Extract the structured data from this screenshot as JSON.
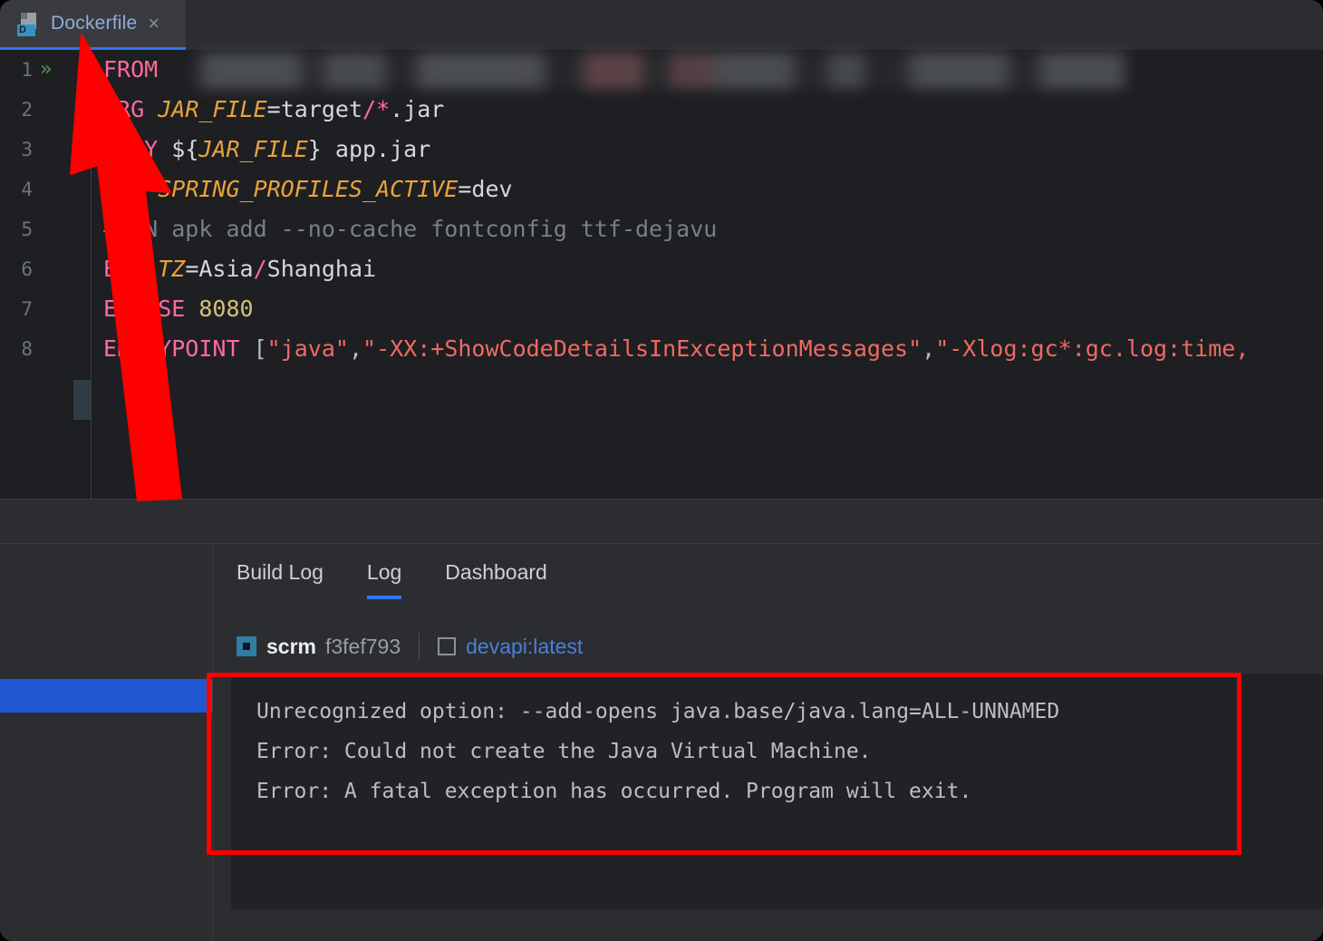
{
  "window": {
    "theme": "jetbrains-dark",
    "background": "#2b2d30",
    "accent": "#3574f0"
  },
  "tab_bar": {
    "tabs": [
      {
        "label": "Dockerfile",
        "icon": "dockerfile-icon",
        "badge": "D",
        "close_glyph": "×",
        "active": true
      }
    ]
  },
  "editor": {
    "gutter": {
      "line_numbers": [
        "1",
        "2",
        "3",
        "4",
        "5",
        "6",
        "7",
        "8"
      ],
      "run_icon_glyph": "»",
      "run_icon_line": 1
    },
    "lines": [
      {
        "number": 1,
        "tokens": [
          {
            "text": "FROM",
            "type": "keyword"
          }
        ],
        "redacted_tail": true,
        "redacted_note": "image name blurred out"
      },
      {
        "number": 2,
        "tokens": [
          {
            "text": "ARG",
            "type": "keyword"
          },
          {
            "text": " ",
            "type": "plain"
          },
          {
            "text": "JAR_FILE",
            "type": "variable"
          },
          {
            "text": "=target",
            "type": "plain"
          },
          {
            "text": "/",
            "type": "punct-pink"
          },
          {
            "text": "*",
            "type": "punct-pink"
          },
          {
            "text": ".jar",
            "type": "plain"
          }
        ]
      },
      {
        "number": 3,
        "tokens": [
          {
            "text": "COPY",
            "type": "keyword"
          },
          {
            "text": " ${",
            "type": "plain"
          },
          {
            "text": "JAR_FILE",
            "type": "variable"
          },
          {
            "text": "} app.jar",
            "type": "plain"
          }
        ]
      },
      {
        "number": 4,
        "tokens": [
          {
            "text": "ARG",
            "type": "keyword"
          },
          {
            "text": " ",
            "type": "plain"
          },
          {
            "text": "SPRING_PROFILES_ACTIVE",
            "type": "variable"
          },
          {
            "text": "=dev",
            "type": "plain"
          }
        ]
      },
      {
        "number": 5,
        "tokens": [
          {
            "text": "#RUN apk add --no-cache fontconfig ttf-dejavu",
            "type": "comment"
          }
        ]
      },
      {
        "number": 6,
        "tokens": [
          {
            "text": "ENV",
            "type": "keyword"
          },
          {
            "text": " ",
            "type": "plain"
          },
          {
            "text": "TZ",
            "type": "variable"
          },
          {
            "text": "=Asia",
            "type": "plain"
          },
          {
            "text": "/",
            "type": "punct-pink"
          },
          {
            "text": "Shanghai",
            "type": "plain"
          }
        ]
      },
      {
        "number": 7,
        "tokens": [
          {
            "text": "EXPOSE",
            "type": "keyword"
          },
          {
            "text": " ",
            "type": "plain"
          },
          {
            "text": "8080",
            "type": "number"
          }
        ]
      },
      {
        "number": 8,
        "tokens": [
          {
            "text": "ENTRYPOINT",
            "type": "keyword"
          },
          {
            "text": " ",
            "type": "plain"
          },
          {
            "text": "[",
            "type": "bracket"
          },
          {
            "text": "\"java\"",
            "type": "string"
          },
          {
            "text": ",",
            "type": "bracket"
          },
          {
            "text": "\"-XX:+ShowCodeDetailsInExceptionMessages\"",
            "type": "string"
          },
          {
            "text": ",",
            "type": "bracket"
          },
          {
            "text": "\"-Xlog:gc*:gc.log:time,",
            "type": "string"
          }
        ],
        "truncated": true
      }
    ]
  },
  "bottom_panel": {
    "tabs": [
      {
        "label": "Build Log",
        "active": false
      },
      {
        "label": "Log",
        "active": true
      },
      {
        "label": "Dashboard",
        "active": false
      }
    ],
    "breadcrumb": {
      "container_icon": "container-icon",
      "container_name": "scrm",
      "container_hash": "f3fef793",
      "image_icon": "image-icon",
      "image_name": "devapi:latest"
    },
    "console_lines": [
      "Unrecognized option: --add-opens java.base/java.lang=ALL-UNNAMED",
      "Error: Could not create the Java Virtual Machine.",
      "Error: A fatal exception has occurred. Program will exit."
    ]
  },
  "annotations": {
    "color": "#ff0000",
    "arrow": {
      "name": "red-arrow-pointing-to-dockerfile-tab",
      "points_to": "Dockerfile tab"
    },
    "highlight_box": {
      "name": "red-rectangle-around-console-errors",
      "surrounds": "console error output"
    }
  }
}
